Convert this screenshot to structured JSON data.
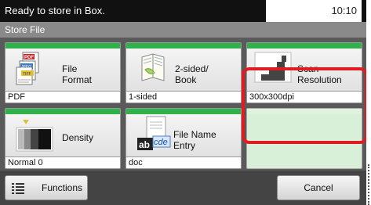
{
  "status": {
    "message": "Ready to store in Box.",
    "time": "10:10"
  },
  "title": "Store File",
  "tiles": [
    {
      "label_line1": "File",
      "label_line2": "Format",
      "value": "PDF",
      "icon": "file-format-icon",
      "icon_badges": [
        "PDF",
        "JPEG",
        "TIFF"
      ]
    },
    {
      "label_line1": "2-sided/",
      "label_line2": "Book",
      "value": "1-sided",
      "icon": "duplex-book-icon"
    },
    {
      "label_line1": "Scan",
      "label_line2": "Resolution",
      "value": "300x300dpi",
      "icon": "scan-resolution-icon"
    },
    {
      "label_line1": "Density",
      "value": "Normal 0",
      "icon": "density-icon"
    },
    {
      "label_line1": "File Name",
      "label_line2": "Entry",
      "value": "doc",
      "icon": "file-name-entry-icon",
      "icon_text": [
        "ab",
        "cde"
      ]
    }
  ],
  "buttons": {
    "functions": "Functions",
    "cancel": "Cancel"
  },
  "colors": {
    "accent_green": "#2fb24a",
    "highlight_red": "#e11b22"
  }
}
